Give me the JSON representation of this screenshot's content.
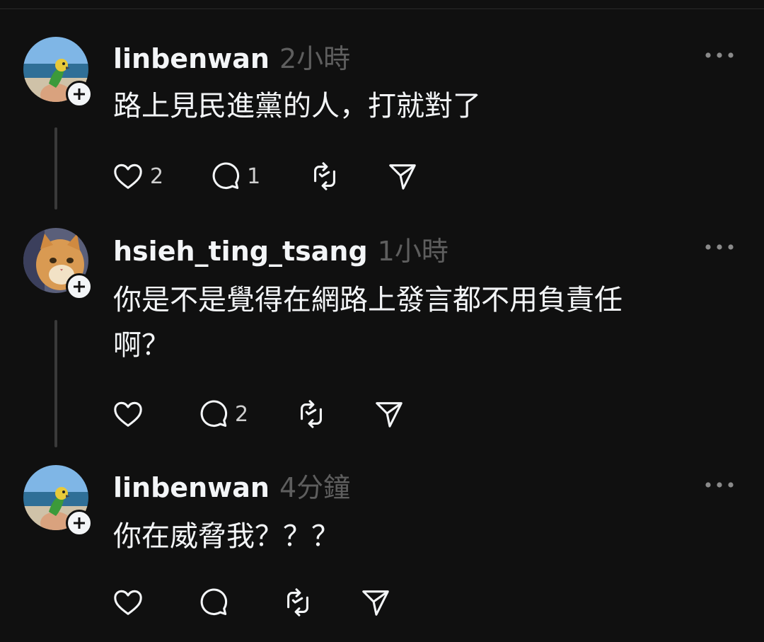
{
  "posts": [
    {
      "username": "linbenwan",
      "time": "2小時",
      "text": "路上見民進黨的人，打就對了",
      "likes": "2",
      "replies": "1",
      "avatar": "parrot-beach-avatar"
    },
    {
      "username": "hsieh_ting_tsang",
      "time": "1小時",
      "text": "你是不是覺得在網路上發言都不用負責任\n啊？",
      "likes": "",
      "replies": "2",
      "avatar": "orange-cat-avatar"
    },
    {
      "username": "linbenwan",
      "time": "4分鐘",
      "text": "你在威脅我？？？",
      "likes": "",
      "replies": "",
      "avatar": "parrot-beach-avatar"
    }
  ],
  "icons": {
    "like": "heart-icon",
    "reply": "comment-icon",
    "repost": "repost-icon",
    "share": "send-icon",
    "more": "more-icon",
    "follow": "plus-icon"
  },
  "colors": {
    "background": "#101010",
    "text": "#f3f5f7",
    "muted": "#5e5e5e",
    "thread_line": "#3a3a3a"
  }
}
